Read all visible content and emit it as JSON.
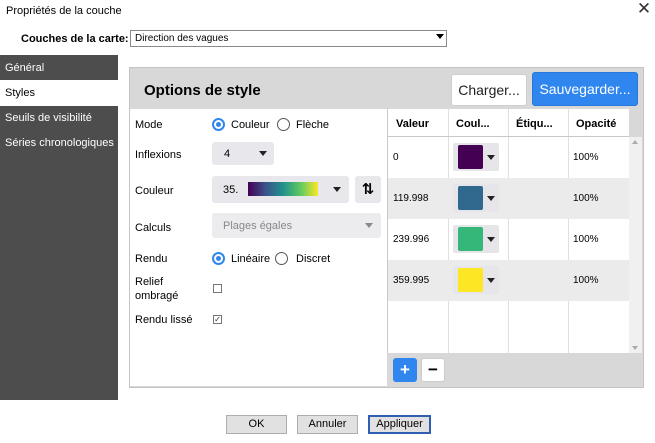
{
  "window": {
    "title": "Propriétés de la couche",
    "close_icon": "close-icon"
  },
  "layer": {
    "label": "Couches de la carte:",
    "selected": "Direction des vagues"
  },
  "sidebar": {
    "items": [
      {
        "label": "Général",
        "active": false
      },
      {
        "label": "Styles",
        "active": true
      },
      {
        "label": "Seuils de visibilité",
        "active": false
      },
      {
        "label": "Séries chronologiques",
        "active": false
      }
    ]
  },
  "style_panel": {
    "title": "Options de style",
    "load_label": "Charger...",
    "save_label": "Sauvegarder..."
  },
  "form": {
    "mode": {
      "label": "Mode",
      "options": [
        "Couleur",
        "Flèche"
      ],
      "selected": "Couleur"
    },
    "inflexions": {
      "label": "Inflexions",
      "value": "4"
    },
    "couleur": {
      "label": "Couleur",
      "value": "35.",
      "gradient": [
        "#440154",
        "#3b528b",
        "#21918c",
        "#5ec962",
        "#fde725"
      ]
    },
    "calculs": {
      "label": "Calculs",
      "value": "Plages égales"
    },
    "rendu": {
      "label": "Rendu",
      "options": [
        "Linéaire",
        "Discret"
      ],
      "selected": "Linéaire"
    },
    "relief": {
      "label_line1": "Relief",
      "label_line2": "ombragé",
      "checked": false
    },
    "rendu_lisse": {
      "label": "Rendu lissé",
      "checked": true
    }
  },
  "table": {
    "headers": [
      "Valeur",
      "Coul...",
      "Étiqu...",
      "Opacité"
    ],
    "rows": [
      {
        "valeur": "0",
        "color": "#440154",
        "etiquette": "",
        "opacite": "100%"
      },
      {
        "valeur": "119.998",
        "color": "#31688e",
        "etiquette": "",
        "opacite": "100%"
      },
      {
        "valeur": "239.996",
        "color": "#35b779",
        "etiquette": "",
        "opacite": "100%"
      },
      {
        "valeur": "359.995",
        "color": "#fde725",
        "etiquette": "",
        "opacite": "100%"
      }
    ],
    "add_label": "+",
    "remove_label": "−"
  },
  "footer": {
    "ok_label": "OK",
    "cancel_label": "Annuler",
    "apply_label": "Appliquer"
  },
  "colors": {
    "accent": "#2f86ef",
    "sidebar_bg": "#4d4d4d"
  }
}
